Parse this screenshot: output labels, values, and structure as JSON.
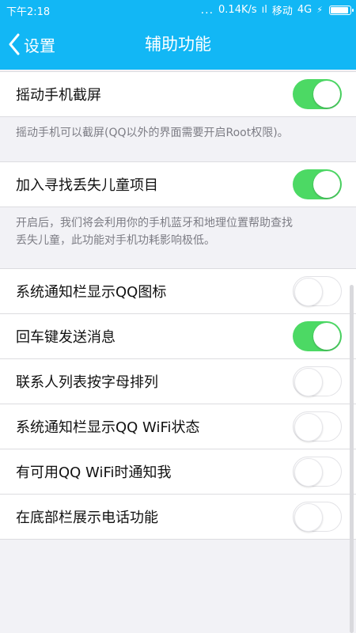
{
  "status_bar": {
    "time": "下午2:18",
    "dots": "...",
    "speed": "0.14K/s",
    "signal": "ıl",
    "carrier": "移动",
    "network": "4G",
    "charging": "⚡"
  },
  "header": {
    "back_label": "设置",
    "title": "辅助功能"
  },
  "sections": [
    {
      "label": "摇动手机截屏",
      "on": true,
      "hint": "摇动手机可以截屏(QQ以外的界面需要开启Root权限)。"
    },
    {
      "label": "加入寻找丢失儿童项目",
      "on": true,
      "hint_line1": "开启后，我们将会利用你的手机蓝牙和地理位置帮助查找",
      "hint_line2": "丢失儿童，此功能对手机功耗影响极低。"
    }
  ],
  "settings": [
    {
      "label": "系统通知栏显示QQ图标",
      "on": false
    },
    {
      "label": "回车键发送消息",
      "on": true
    },
    {
      "label": "联系人列表按字母排列",
      "on": false
    },
    {
      "label": "系统通知栏显示QQ WiFi状态",
      "on": false
    },
    {
      "label": "有可用QQ WiFi时通知我",
      "on": false
    },
    {
      "label": "在底部栏展示电话功能",
      "on": false
    }
  ],
  "colors": {
    "accent": "#12b7f5",
    "switch_on": "#4cd964",
    "background": "#f2f2f6"
  }
}
